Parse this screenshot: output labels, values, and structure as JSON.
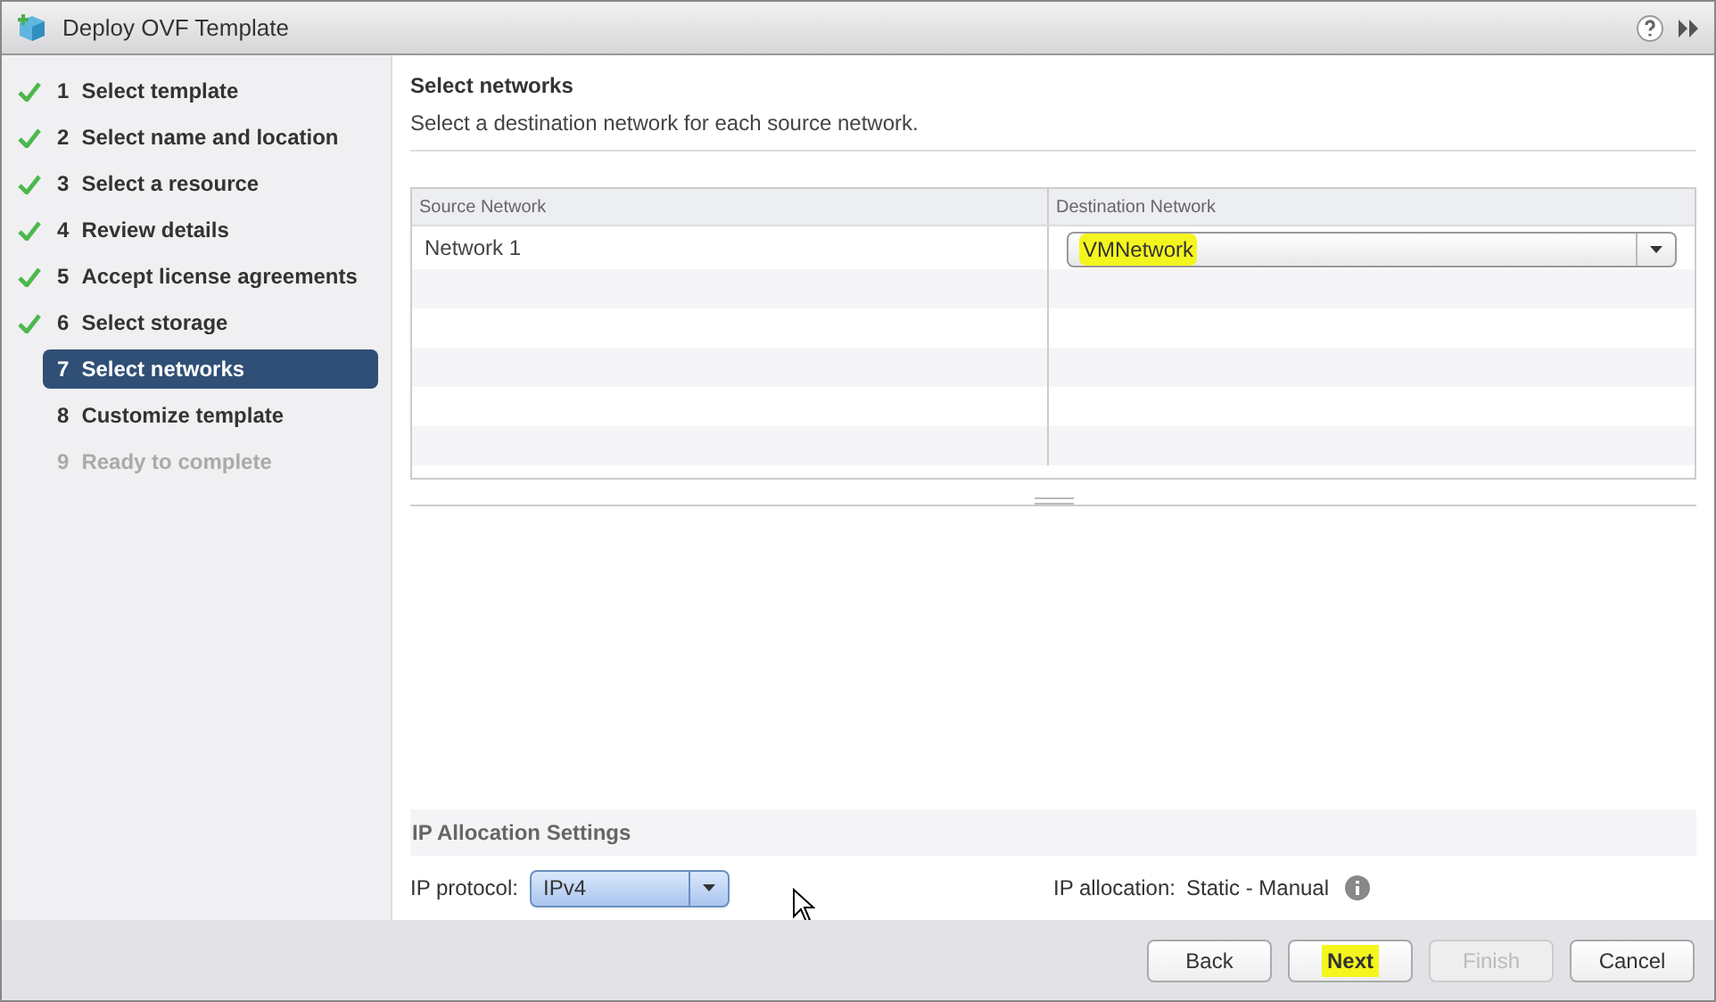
{
  "window": {
    "title": "Deploy OVF Template"
  },
  "steps": [
    {
      "number": "1",
      "label": "Select template",
      "checked": true,
      "selected": false,
      "disabled": false
    },
    {
      "number": "2",
      "label": "Select name and location",
      "checked": true,
      "selected": false,
      "disabled": false
    },
    {
      "number": "3",
      "label": "Select a resource",
      "checked": true,
      "selected": false,
      "disabled": false
    },
    {
      "number": "4",
      "label": "Review details",
      "checked": true,
      "selected": false,
      "disabled": false
    },
    {
      "number": "5",
      "label": "Accept license agreements",
      "checked": true,
      "selected": false,
      "disabled": false
    },
    {
      "number": "6",
      "label": "Select storage",
      "checked": true,
      "selected": false,
      "disabled": false
    },
    {
      "number": "7",
      "label": "Select networks",
      "checked": false,
      "selected": true,
      "disabled": false
    },
    {
      "number": "8",
      "label": "Customize template",
      "checked": false,
      "selected": false,
      "disabled": false
    },
    {
      "number": "9",
      "label": "Ready to complete",
      "checked": false,
      "selected": false,
      "disabled": true
    }
  ],
  "page": {
    "title": "Select networks",
    "subtitle": "Select a destination network for each source network."
  },
  "table": {
    "columns": [
      "Source Network",
      "Destination Network"
    ],
    "rows": [
      {
        "source": "Network 1",
        "destination": {
          "value": "VMNetwork",
          "highlighted": true
        }
      }
    ]
  },
  "ip_settings": {
    "title": "IP Allocation Settings",
    "protocol_label": "IP protocol:",
    "protocol_value": "IPv4",
    "allocation_label": "IP allocation:",
    "allocation_value": "Static - Manual"
  },
  "buttons": [
    {
      "label": "Back",
      "disabled": false,
      "highlighted": false
    },
    {
      "label": "Next",
      "disabled": false,
      "highlighted": true
    },
    {
      "label": "Finish",
      "disabled": true,
      "highlighted": false
    },
    {
      "label": "Cancel",
      "disabled": false,
      "highlighted": false
    }
  ]
}
